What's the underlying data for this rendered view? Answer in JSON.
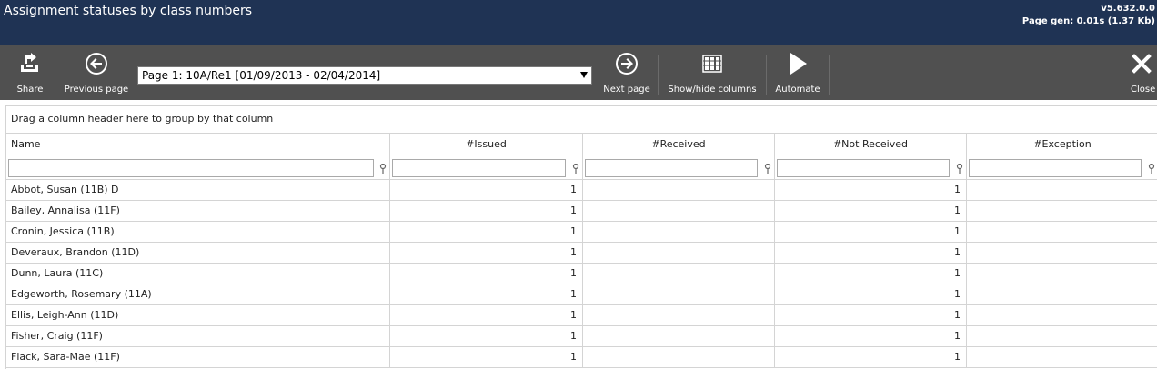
{
  "header": {
    "title": "Assignment statuses by class numbers",
    "version": "v5.632.0.0",
    "page_gen": "Page gen: 0.01s (1.37 Kb)"
  },
  "toolbar": {
    "share_label": "Share",
    "previous_label": "Previous page",
    "page_select_value": "Page 1: 10A/Re1 [01/09/2013 - 02/04/2014]",
    "next_label": "Next page",
    "columns_label": "Show/hide columns",
    "automate_label": "Automate",
    "close_label": "Close"
  },
  "grid": {
    "group_panel_text": "Drag a column header here to group by that column",
    "columns": [
      "Name",
      "#Issued",
      "#Received",
      "#Not Received",
      "#Exception"
    ],
    "rows": [
      {
        "name": "Abbot, Susan (11B) D",
        "issued": "1",
        "received": "",
        "not_received": "1",
        "exception": ""
      },
      {
        "name": "Bailey, Annalisa (11F)",
        "issued": "1",
        "received": "",
        "not_received": "1",
        "exception": ""
      },
      {
        "name": "Cronin, Jessica (11B)",
        "issued": "1",
        "received": "",
        "not_received": "1",
        "exception": ""
      },
      {
        "name": "Deveraux, Brandon (11D)",
        "issued": "1",
        "received": "",
        "not_received": "1",
        "exception": ""
      },
      {
        "name": "Dunn, Laura (11C)",
        "issued": "1",
        "received": "",
        "not_received": "1",
        "exception": ""
      },
      {
        "name": "Edgeworth, Rosemary (11A)",
        "issued": "1",
        "received": "",
        "not_received": "1",
        "exception": ""
      },
      {
        "name": "Ellis, Leigh-Ann (11D)",
        "issued": "1",
        "received": "",
        "not_received": "1",
        "exception": ""
      },
      {
        "name": "Fisher, Craig (11F)",
        "issued": "1",
        "received": "",
        "not_received": "1",
        "exception": ""
      },
      {
        "name": "Flack, Sara-Mae (11F)",
        "issued": "1",
        "received": "",
        "not_received": "1",
        "exception": ""
      }
    ]
  },
  "colors": {
    "header_bg": "#1f3354",
    "toolbar_bg": "#505050",
    "grid_border": "#d4d4d4"
  },
  "icons": {
    "share": "share-icon",
    "previous": "circle-arrow-left-icon",
    "next": "circle-arrow-right-icon",
    "columns": "columns-icon",
    "automate": "play-icon",
    "close": "close-icon",
    "filter": "filter-pin-icon"
  }
}
